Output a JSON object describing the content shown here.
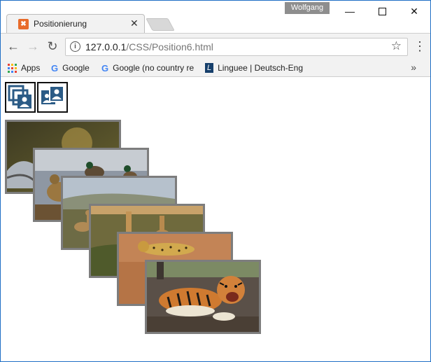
{
  "window": {
    "user": "Wolfgang",
    "tab_title": "Positionierung",
    "minimize": "–",
    "maximize": "☐",
    "close": "✕"
  },
  "toolbar": {
    "url_host": "127.0.0.1",
    "url_path": "/CSS/Position6.html"
  },
  "bookmarks": {
    "items": [
      {
        "label": "Apps",
        "icon": "apps-grid-icon"
      },
      {
        "label": "Google",
        "icon": "google-icon"
      },
      {
        "label": "Google (no country re",
        "icon": "google-icon"
      },
      {
        "label": "Linguee | Deutsch-Eng",
        "icon": "linguee-icon"
      }
    ],
    "more": "»"
  },
  "page": {
    "icons": [
      "stacked-windows-icon",
      "user-cards-icon"
    ],
    "photos": [
      "heron",
      "ducks",
      "deer",
      "giraffes",
      "leopard",
      "tiger"
    ]
  }
}
